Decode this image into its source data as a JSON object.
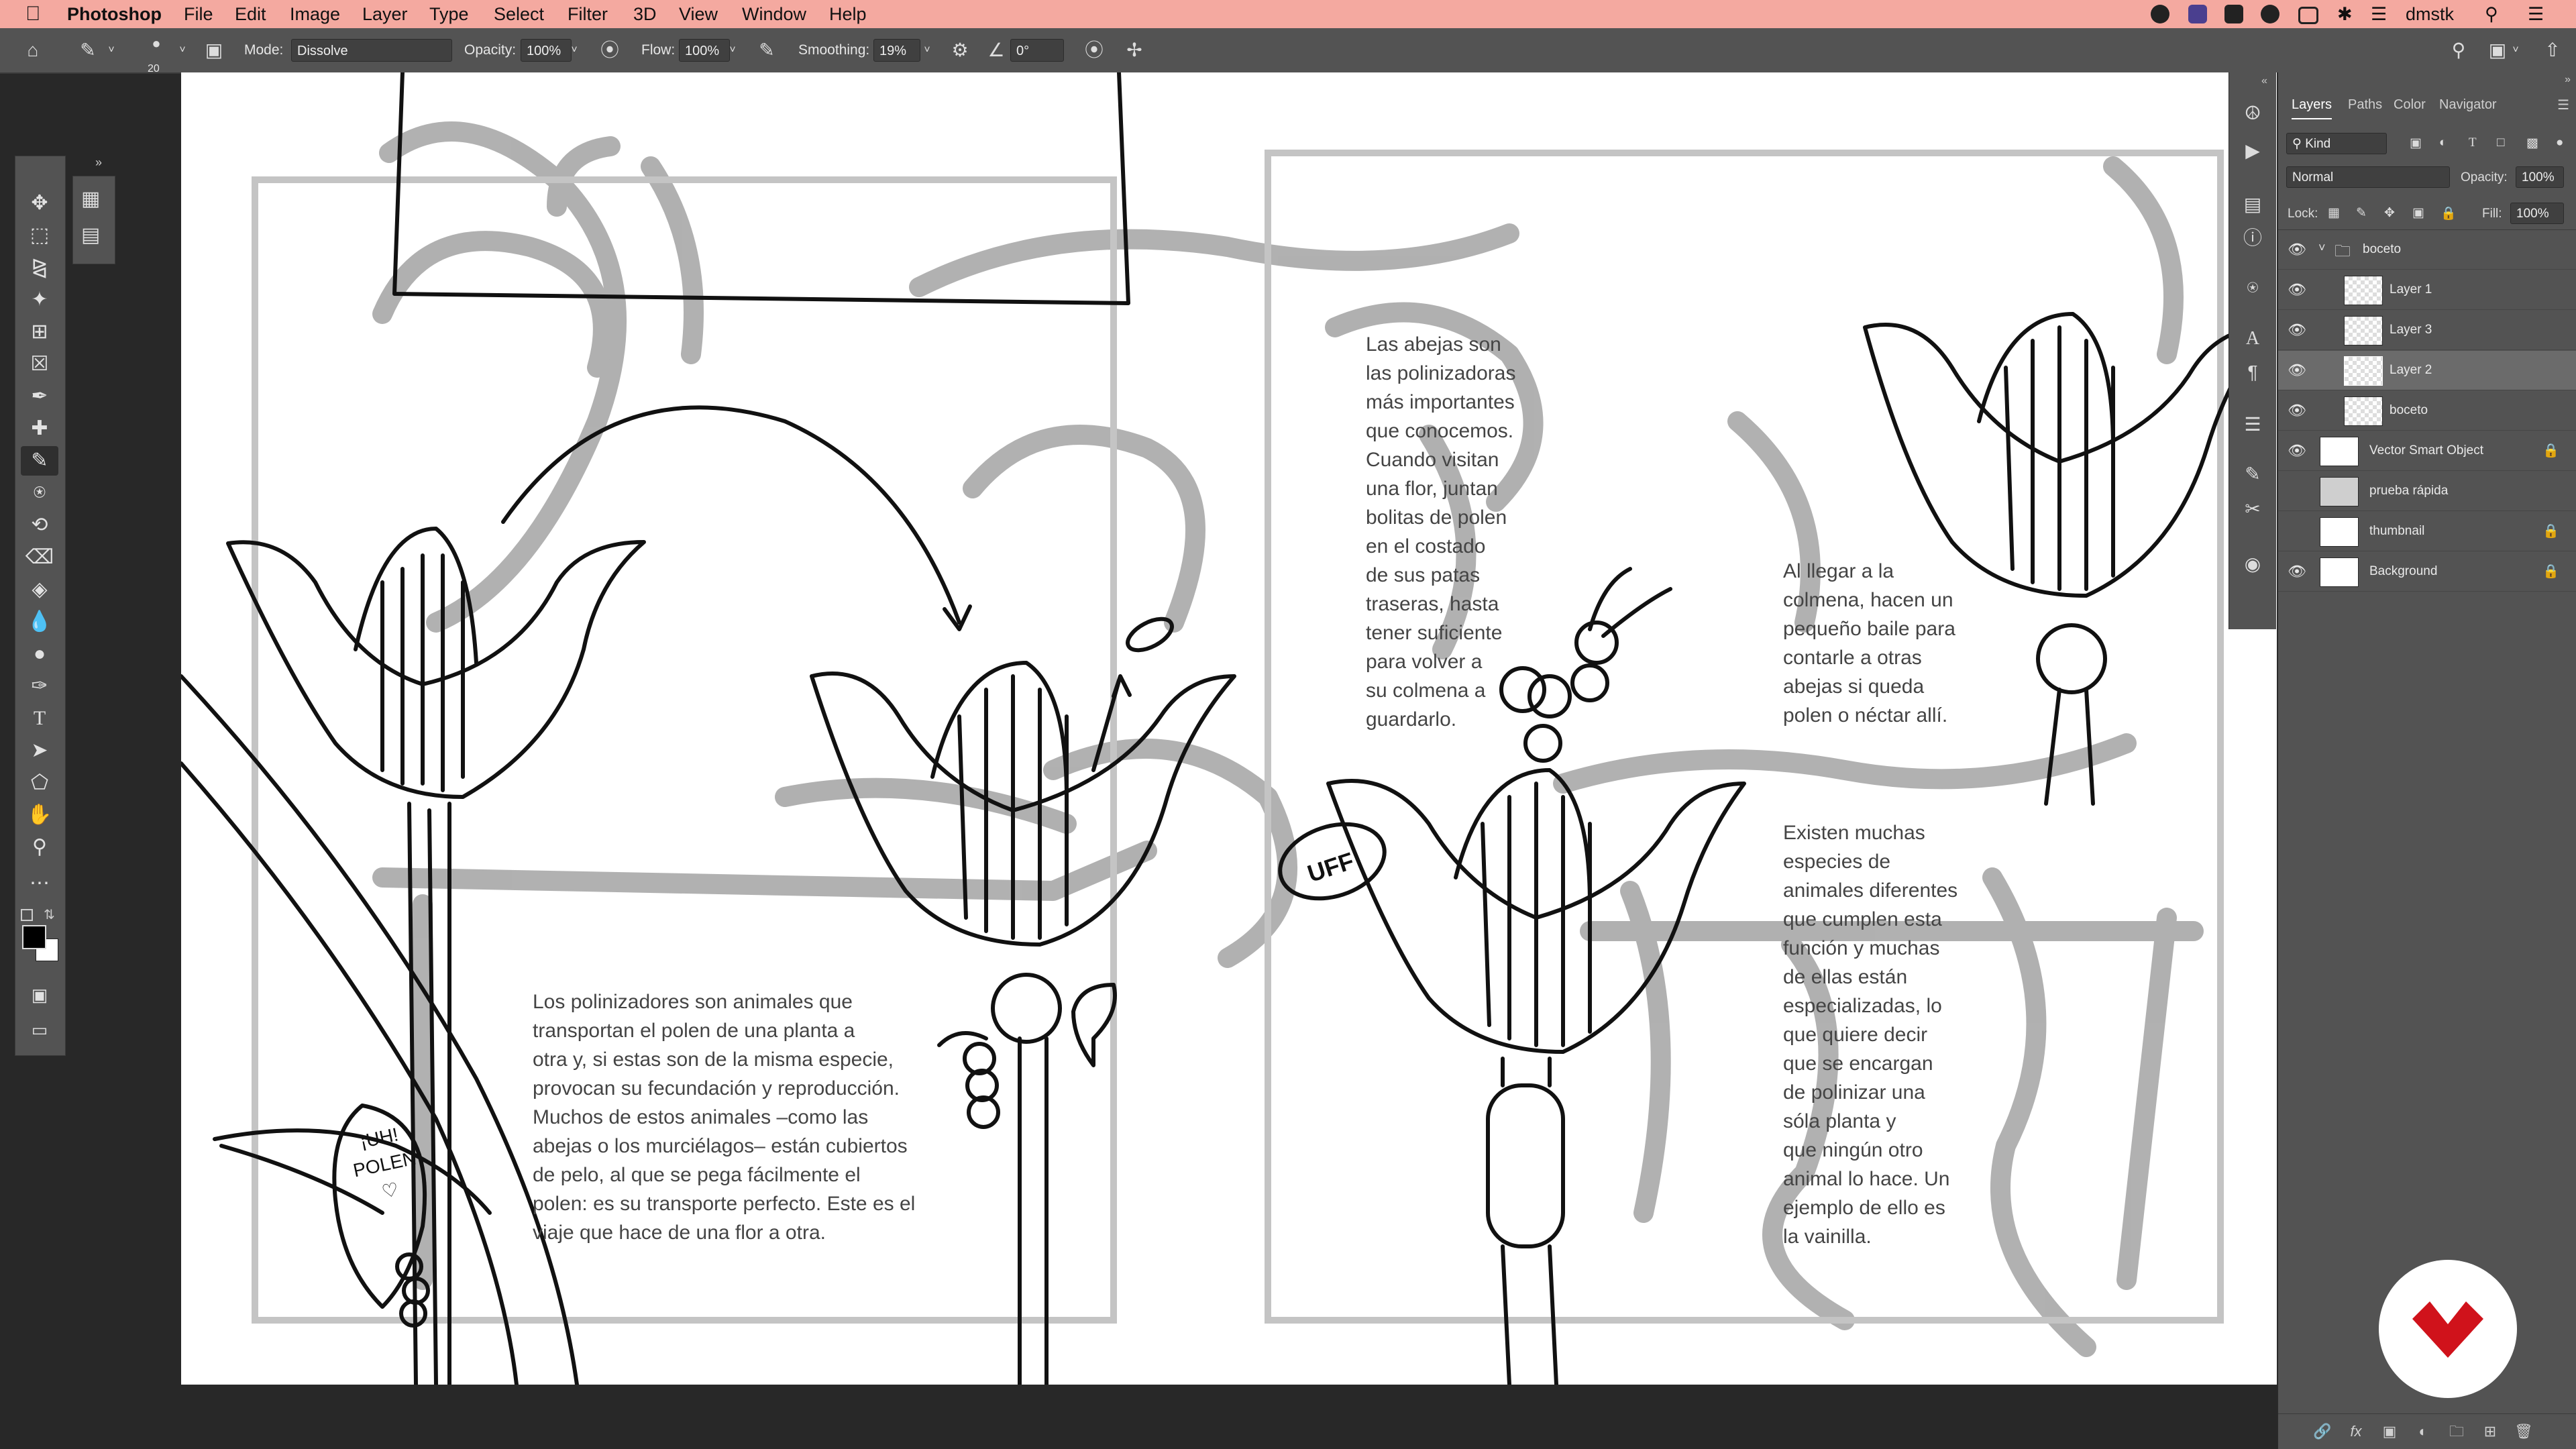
{
  "menubar": {
    "app_name": "Photoshop",
    "items": [
      "File",
      "Edit",
      "Image",
      "Layer",
      "Type",
      "Select",
      "Filter",
      "3D",
      "View",
      "Window",
      "Help"
    ],
    "user": "dmstk"
  },
  "options": {
    "brush_size": "20",
    "mode_label": "Mode:",
    "mode_value": "Dissolve",
    "opacity_label": "Opacity:",
    "opacity_value": "100%",
    "flow_label": "Flow:",
    "flow_value": "100%",
    "smoothing_label": "Smoothing:",
    "smoothing_value": "19%",
    "angle_value": "0°"
  },
  "canvas_text": {
    "pollinators": "Los polinizadores son animales que\ntransportan el polen de una planta a\notra y, si estas son de la misma especie,\nprovocan su fecundación y reproducción.\nMuchos de estos animales –como las\nabejas o los murciélagos– están cubiertos\nde pelo, al que se pega fácilmente el\npolen: es su transporte perfecto. Este es el\nviaje que hace de una flor a otra.",
    "bees": "Las abejas son\nlas polinizadoras\nmás importantes\nque conocemos.\nCuando visitan\nuna flor, juntan\nbolitas de polen\nen el costado\nde sus patas\ntraseras, hasta\ntener suficiente\npara volver a\nsu colmena a\nguardarlo.",
    "hive": "Al llegar a la\ncolmena, hacen un\npequeño baile para\ncontarle a otras\nabejas si queda\npolen o néctar allí.",
    "species": "Existen muchas\nespecies de\nanimales diferentes\nque cumplen esta\nfunción y muchas\nde ellas están\nespecializadas, lo\nque quiere decir\nque se encargan\nde polinizar una\nsóla planta y\nque ningún otro\nanimal lo hace. Un\nejemplo de ello es\nla vainilla.",
    "uff": "UFF",
    "polen_sign": "¡UH!\nPOLEN\n♡"
  },
  "panel": {
    "tabs": [
      "Layers",
      "Paths",
      "Color",
      "Navigator"
    ],
    "kind_label": "Kind",
    "blend_mode": "Normal",
    "opacity_label": "Opacity:",
    "opacity_value": "100%",
    "lock_label": "Lock:",
    "fill_label": "Fill:",
    "fill_value": "100%",
    "layers": [
      {
        "name": "boceto",
        "type": "group",
        "visible": true,
        "locked": false,
        "selected": false
      },
      {
        "name": "Layer 1",
        "type": "layer",
        "visible": true,
        "locked": false,
        "selected": false
      },
      {
        "name": "Layer 3",
        "type": "layer",
        "visible": true,
        "locked": false,
        "selected": false
      },
      {
        "name": "Layer 2",
        "type": "layer",
        "visible": true,
        "locked": false,
        "selected": true
      },
      {
        "name": "boceto",
        "type": "layer",
        "visible": true,
        "locked": false,
        "selected": false
      },
      {
        "name": "Vector Smart Object",
        "type": "smart",
        "visible": true,
        "locked": true,
        "selected": false
      },
      {
        "name": "prueba rápida",
        "type": "layer",
        "visible": false,
        "locked": false,
        "selected": false
      },
      {
        "name": "thumbnail",
        "type": "layer",
        "visible": false,
        "locked": true,
        "selected": false
      },
      {
        "name": "Background",
        "type": "background",
        "visible": true,
        "locked": true,
        "selected": false
      }
    ]
  },
  "colors": {
    "menubar_bg": "#f4a9a0",
    "ui_panel": "#535353",
    "canvas_bg": "#ffffff",
    "sketch_gray": "#a8a8a8",
    "ink": "#111111",
    "brand_red": "#d0121b"
  },
  "icons": {
    "tools": [
      "move",
      "marquee",
      "lasso",
      "magic-wand",
      "crop",
      "frame",
      "eyedropper",
      "healing",
      "brush",
      "stamp",
      "history-brush",
      "eraser",
      "paint-bucket",
      "blur",
      "dodge",
      "pen",
      "type",
      "path-select",
      "shape",
      "hand",
      "zoom",
      "more"
    ]
  }
}
